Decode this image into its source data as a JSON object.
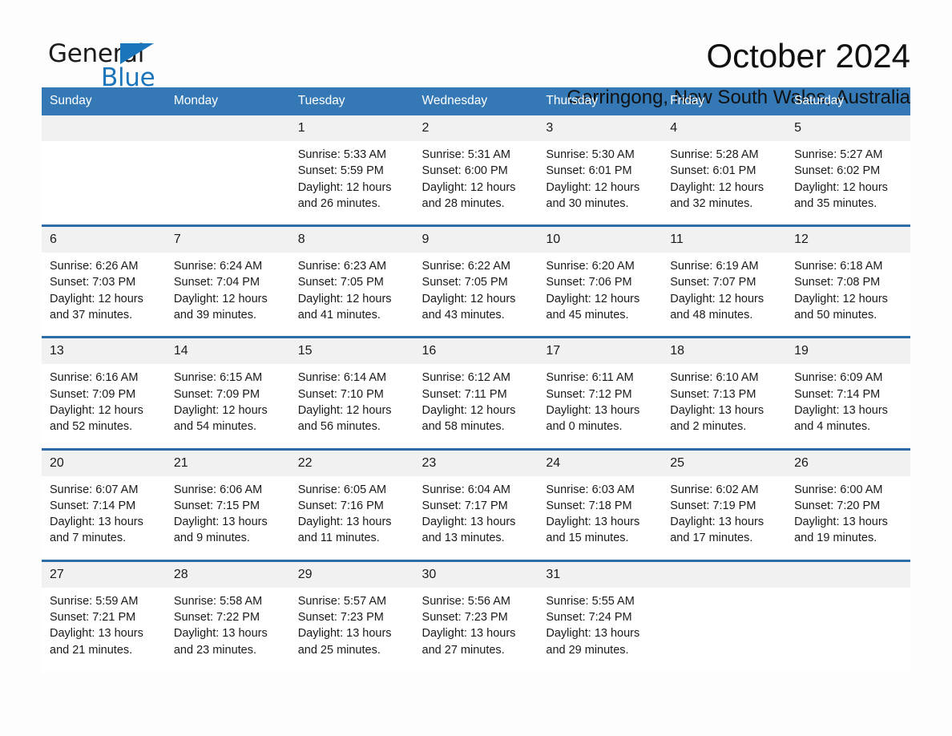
{
  "brand": {
    "name_part1": "General",
    "name_part2": "Blue",
    "accent_color": "#1b75bb"
  },
  "header": {
    "title": "October 2024",
    "location": "Gerringong, New South Wales, Australia"
  },
  "theme": {
    "header_row_blue": "#3479b6",
    "week_divider_blue": "#2e6ca8",
    "daynum_band_gray": "#f1f1f1"
  },
  "calendar": {
    "weekday_headers": [
      "Sunday",
      "Monday",
      "Tuesday",
      "Wednesday",
      "Thursday",
      "Friday",
      "Saturday"
    ],
    "weeks": [
      [
        {
          "day": "",
          "lines": []
        },
        {
          "day": "",
          "lines": []
        },
        {
          "day": "1",
          "lines": [
            "Sunrise: 5:33 AM",
            "Sunset: 5:59 PM",
            "Daylight: 12 hours",
            "and 26 minutes."
          ]
        },
        {
          "day": "2",
          "lines": [
            "Sunrise: 5:31 AM",
            "Sunset: 6:00 PM",
            "Daylight: 12 hours",
            "and 28 minutes."
          ]
        },
        {
          "day": "3",
          "lines": [
            "Sunrise: 5:30 AM",
            "Sunset: 6:01 PM",
            "Daylight: 12 hours",
            "and 30 minutes."
          ]
        },
        {
          "day": "4",
          "lines": [
            "Sunrise: 5:28 AM",
            "Sunset: 6:01 PM",
            "Daylight: 12 hours",
            "and 32 minutes."
          ]
        },
        {
          "day": "5",
          "lines": [
            "Sunrise: 5:27 AM",
            "Sunset: 6:02 PM",
            "Daylight: 12 hours",
            "and 35 minutes."
          ]
        }
      ],
      [
        {
          "day": "6",
          "lines": [
            "Sunrise: 6:26 AM",
            "Sunset: 7:03 PM",
            "Daylight: 12 hours",
            "and 37 minutes."
          ]
        },
        {
          "day": "7",
          "lines": [
            "Sunrise: 6:24 AM",
            "Sunset: 7:04 PM",
            "Daylight: 12 hours",
            "and 39 minutes."
          ]
        },
        {
          "day": "8",
          "lines": [
            "Sunrise: 6:23 AM",
            "Sunset: 7:05 PM",
            "Daylight: 12 hours",
            "and 41 minutes."
          ]
        },
        {
          "day": "9",
          "lines": [
            "Sunrise: 6:22 AM",
            "Sunset: 7:05 PM",
            "Daylight: 12 hours",
            "and 43 minutes."
          ]
        },
        {
          "day": "10",
          "lines": [
            "Sunrise: 6:20 AM",
            "Sunset: 7:06 PM",
            "Daylight: 12 hours",
            "and 45 minutes."
          ]
        },
        {
          "day": "11",
          "lines": [
            "Sunrise: 6:19 AM",
            "Sunset: 7:07 PM",
            "Daylight: 12 hours",
            "and 48 minutes."
          ]
        },
        {
          "day": "12",
          "lines": [
            "Sunrise: 6:18 AM",
            "Sunset: 7:08 PM",
            "Daylight: 12 hours",
            "and 50 minutes."
          ]
        }
      ],
      [
        {
          "day": "13",
          "lines": [
            "Sunrise: 6:16 AM",
            "Sunset: 7:09 PM",
            "Daylight: 12 hours",
            "and 52 minutes."
          ]
        },
        {
          "day": "14",
          "lines": [
            "Sunrise: 6:15 AM",
            "Sunset: 7:09 PM",
            "Daylight: 12 hours",
            "and 54 minutes."
          ]
        },
        {
          "day": "15",
          "lines": [
            "Sunrise: 6:14 AM",
            "Sunset: 7:10 PM",
            "Daylight: 12 hours",
            "and 56 minutes."
          ]
        },
        {
          "day": "16",
          "lines": [
            "Sunrise: 6:12 AM",
            "Sunset: 7:11 PM",
            "Daylight: 12 hours",
            "and 58 minutes."
          ]
        },
        {
          "day": "17",
          "lines": [
            "Sunrise: 6:11 AM",
            "Sunset: 7:12 PM",
            "Daylight: 13 hours",
            "and 0 minutes."
          ]
        },
        {
          "day": "18",
          "lines": [
            "Sunrise: 6:10 AM",
            "Sunset: 7:13 PM",
            "Daylight: 13 hours",
            "and 2 minutes."
          ]
        },
        {
          "day": "19",
          "lines": [
            "Sunrise: 6:09 AM",
            "Sunset: 7:14 PM",
            "Daylight: 13 hours",
            "and 4 minutes."
          ]
        }
      ],
      [
        {
          "day": "20",
          "lines": [
            "Sunrise: 6:07 AM",
            "Sunset: 7:14 PM",
            "Daylight: 13 hours",
            "and 7 minutes."
          ]
        },
        {
          "day": "21",
          "lines": [
            "Sunrise: 6:06 AM",
            "Sunset: 7:15 PM",
            "Daylight: 13 hours",
            "and 9 minutes."
          ]
        },
        {
          "day": "22",
          "lines": [
            "Sunrise: 6:05 AM",
            "Sunset: 7:16 PM",
            "Daylight: 13 hours",
            "and 11 minutes."
          ]
        },
        {
          "day": "23",
          "lines": [
            "Sunrise: 6:04 AM",
            "Sunset: 7:17 PM",
            "Daylight: 13 hours",
            "and 13 minutes."
          ]
        },
        {
          "day": "24",
          "lines": [
            "Sunrise: 6:03 AM",
            "Sunset: 7:18 PM",
            "Daylight: 13 hours",
            "and 15 minutes."
          ]
        },
        {
          "day": "25",
          "lines": [
            "Sunrise: 6:02 AM",
            "Sunset: 7:19 PM",
            "Daylight: 13 hours",
            "and 17 minutes."
          ]
        },
        {
          "day": "26",
          "lines": [
            "Sunrise: 6:00 AM",
            "Sunset: 7:20 PM",
            "Daylight: 13 hours",
            "and 19 minutes."
          ]
        }
      ],
      [
        {
          "day": "27",
          "lines": [
            "Sunrise: 5:59 AM",
            "Sunset: 7:21 PM",
            "Daylight: 13 hours",
            "and 21 minutes."
          ]
        },
        {
          "day": "28",
          "lines": [
            "Sunrise: 5:58 AM",
            "Sunset: 7:22 PM",
            "Daylight: 13 hours",
            "and 23 minutes."
          ]
        },
        {
          "day": "29",
          "lines": [
            "Sunrise: 5:57 AM",
            "Sunset: 7:23 PM",
            "Daylight: 13 hours",
            "and 25 minutes."
          ]
        },
        {
          "day": "30",
          "lines": [
            "Sunrise: 5:56 AM",
            "Sunset: 7:23 PM",
            "Daylight: 13 hours",
            "and 27 minutes."
          ]
        },
        {
          "day": "31",
          "lines": [
            "Sunrise: 5:55 AM",
            "Sunset: 7:24 PM",
            "Daylight: 13 hours",
            "and 29 minutes."
          ]
        },
        {
          "day": "",
          "lines": []
        },
        {
          "day": "",
          "lines": []
        }
      ]
    ]
  }
}
